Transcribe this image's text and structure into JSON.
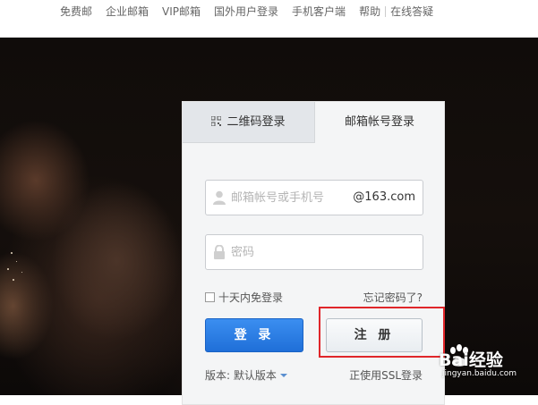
{
  "top_nav": {
    "links": [
      "免费邮",
      "企业邮箱",
      "VIP邮箱",
      "国外用户登录",
      "手机客户端",
      "帮助"
    ],
    "online_help": "在线答疑"
  },
  "login": {
    "tabs": {
      "qr": "二维码登录",
      "account": "邮箱帐号登录"
    },
    "username": {
      "placeholder": "邮箱帐号或手机号",
      "value": "",
      "suffix": "@163.com"
    },
    "password": {
      "placeholder": "密码",
      "value": ""
    },
    "remember_label": "十天内免登录",
    "forgot_label": "忘记密码了?",
    "login_button": "登 录",
    "register_button": "注 册",
    "version_label": "版本: 默认版本",
    "ssl_label": "正使用SSL登录"
  },
  "watermark": {
    "brand": "Bai经验",
    "url": "jingyan.baidu.com"
  },
  "colors": {
    "login_button": "#2478e2",
    "highlight_box": "#e0262a",
    "hero_background": "#120d0b"
  },
  "icons": [
    "qr-code-icon",
    "user-icon",
    "lock-icon",
    "caret-down-icon",
    "paw-icon"
  ]
}
